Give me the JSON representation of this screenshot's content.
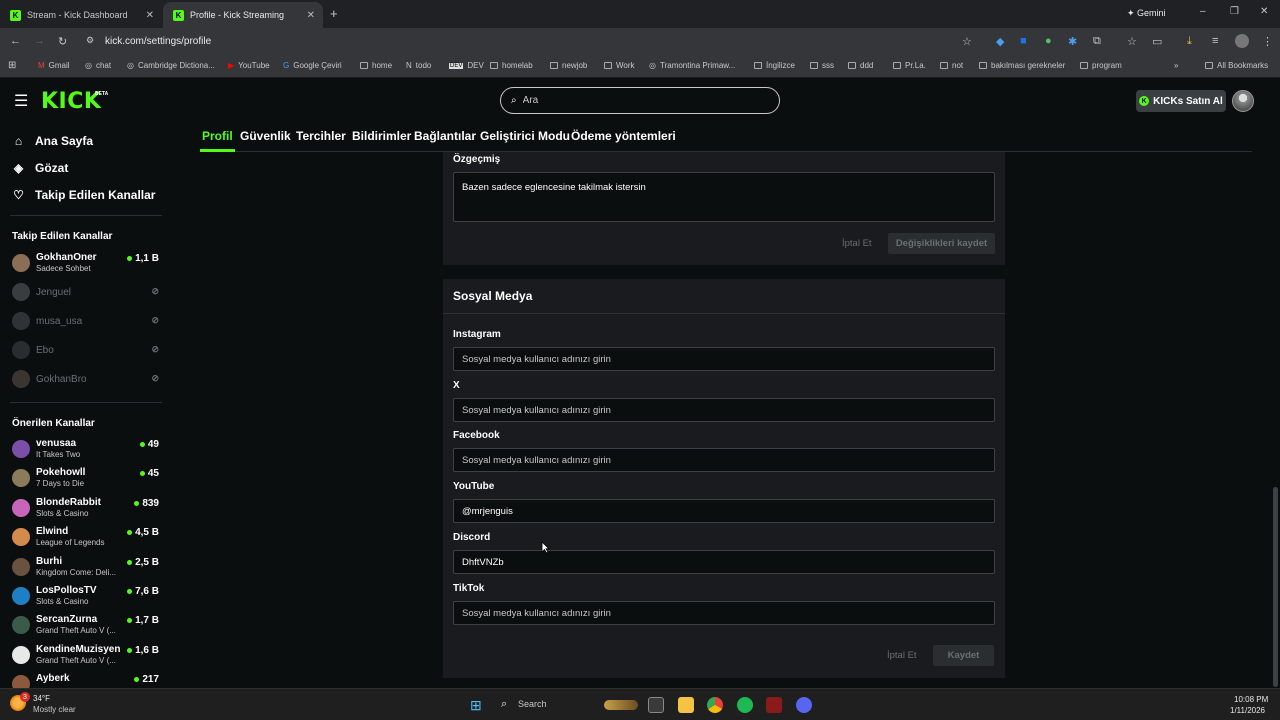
{
  "browser": {
    "tabs": [
      {
        "title": "Stream - Kick Dashboard"
      },
      {
        "title": "Profile - Kick Streaming"
      }
    ],
    "gemini_label": "Gemini",
    "url": "kick.com/settings/profile",
    "bookmarks": [
      "Gmail",
      "chat",
      "Cambridge Dictiona...",
      "YouTube",
      "Google Çeviri",
      "home",
      "todo",
      "DEV",
      "homelab",
      "newjob",
      "Work",
      "Tramontina Primaw...",
      "İngilizce",
      "sss",
      "ddd",
      "Pr.La.",
      "not",
      "bakılması gerekneler",
      "program"
    ],
    "all_bookmarks": "All Bookmarks"
  },
  "header": {
    "logo": "KICK",
    "logo_badge": "BETA",
    "search_placeholder": "Ara",
    "buy_kicks": "KICKs Satın Al"
  },
  "sidebar": {
    "nav": [
      {
        "label": "Ana Sayfa",
        "icon": "home-icon"
      },
      {
        "label": "Gözat",
        "icon": "compass-icon"
      },
      {
        "label": "Takip Edilen Kanallar",
        "icon": "heart-icon"
      }
    ],
    "followed_title": "Takip Edilen Kanallar",
    "followed": [
      {
        "name": "GokhanOner",
        "category": "Sadece Sohbet",
        "viewers": "1,1 B",
        "live": true
      },
      {
        "name": "Jenguel",
        "category": "",
        "viewers": "",
        "live": false
      },
      {
        "name": "musa_usa",
        "category": "",
        "viewers": "",
        "live": false
      },
      {
        "name": "Ebo",
        "category": "",
        "viewers": "",
        "live": false
      },
      {
        "name": "GokhanBro",
        "category": "",
        "viewers": "",
        "live": false
      }
    ],
    "recommended_title": "Önerilen Kanallar",
    "recommended": [
      {
        "name": "venusaa",
        "category": "It Takes Two",
        "viewers": "49",
        "color": "#7b4fa8"
      },
      {
        "name": "Pokehowll",
        "category": "7 Days to Die",
        "viewers": "45",
        "color": "#8a7b5a"
      },
      {
        "name": "BlondeRabbit",
        "category": "Slots & Casino",
        "viewers": "839",
        "color": "#c766b8"
      },
      {
        "name": "Elwind",
        "category": "League of Legends",
        "viewers": "4,5 B",
        "color": "#d48a4a"
      },
      {
        "name": "Burhi",
        "category": "Kingdom Come: Deli...",
        "viewers": "2,5 B",
        "color": "#6a5240"
      },
      {
        "name": "LosPollosTV",
        "category": "Slots & Casino",
        "viewers": "7,6 B",
        "color": "#1f7fc4"
      },
      {
        "name": "SercanZurna",
        "category": "Grand Theft Auto V (...",
        "viewers": "1,7 B",
        "color": "#3b5b4a"
      },
      {
        "name": "KendineMuzisyen",
        "category": "Grand Theft Auto V (...",
        "viewers": "1,6 B",
        "color": "#e8e8e8"
      },
      {
        "name": "Ayberk",
        "category": "",
        "viewers": "217",
        "color": "#8b5a3c"
      }
    ]
  },
  "settings_tabs": [
    "Profil",
    "Güvenlik",
    "Tercihler",
    "Bildirimler",
    "Bağlantılar",
    "Geliştirici Modu",
    "Ödeme yöntemleri"
  ],
  "bio": {
    "label": "Özgeçmiş",
    "value": "Bazen sadece eglencesine takilmak istersin",
    "cancel": "İptal Et",
    "save": "Değişiklikleri kaydet"
  },
  "social": {
    "title": "Sosyal Medya",
    "placeholder": "Sosyal medya kullanıcı adınızı girin",
    "fields": [
      {
        "label": "Instagram",
        "value": ""
      },
      {
        "label": "X",
        "value": ""
      },
      {
        "label": "Facebook",
        "value": ""
      },
      {
        "label": "YouTube",
        "value": "@mrjenguis"
      },
      {
        "label": "Discord",
        "value": "DhftVNZb"
      },
      {
        "label": "TikTok",
        "value": ""
      }
    ],
    "cancel": "İptal Et",
    "save": "Kaydet"
  },
  "taskbar": {
    "weather_temp": "34°F",
    "weather_desc": "Mostly clear",
    "search": "Search",
    "time": "10:08 PM",
    "date": "1/11/2026",
    "weather_badge": "3"
  }
}
